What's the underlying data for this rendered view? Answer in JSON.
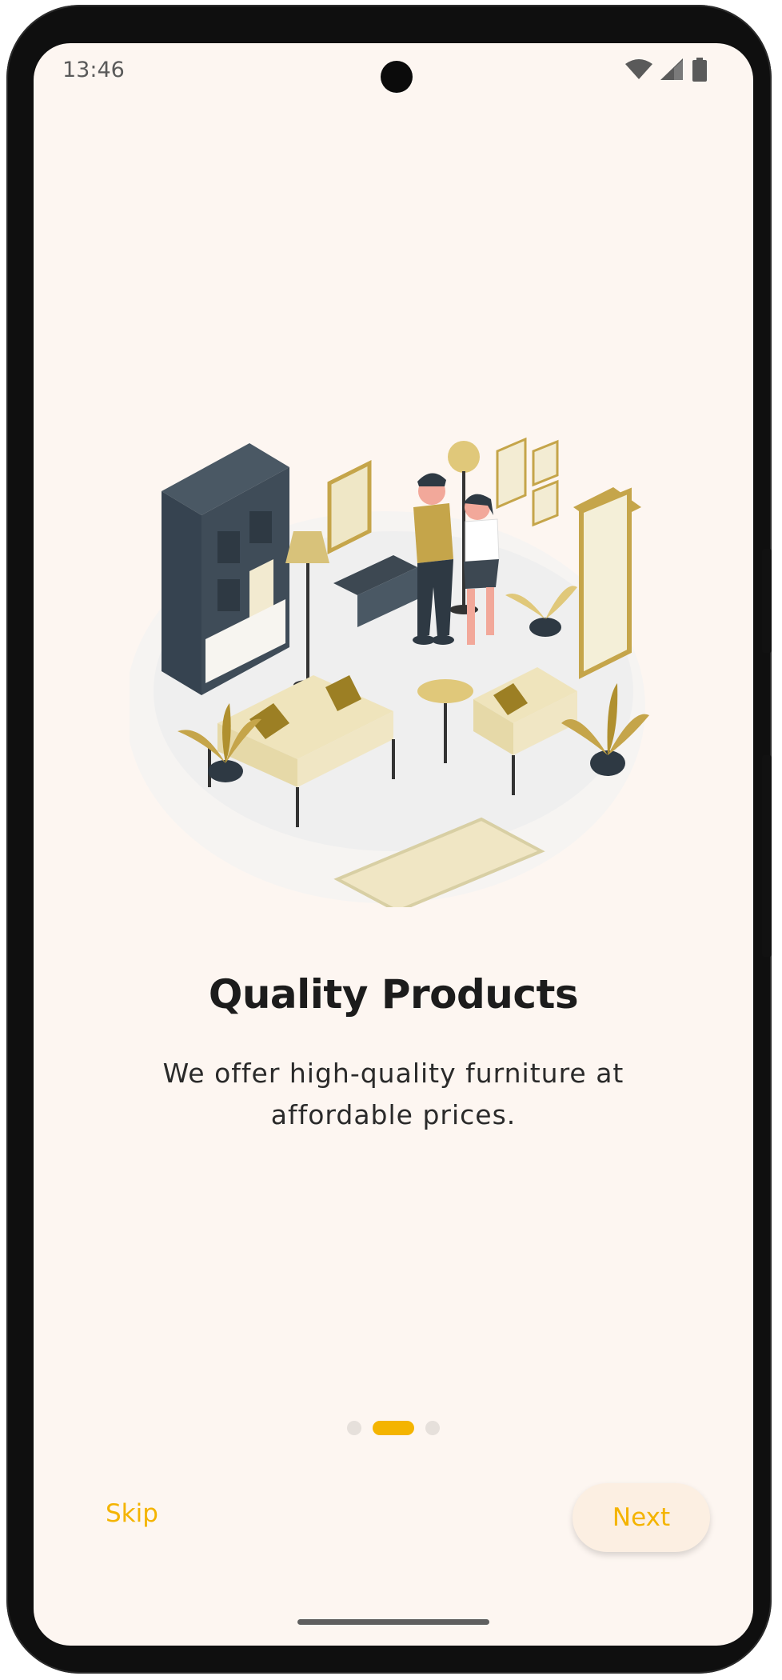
{
  "status_bar": {
    "time": "13:46",
    "icons": [
      "wifi-icon",
      "signal-icon",
      "battery-icon"
    ]
  },
  "onboarding": {
    "title": "Quality Products",
    "description": "We offer high-quality furniture at affordable prices.",
    "page_indicator": {
      "total": 3,
      "active_index": 1
    },
    "skip_label": "Skip",
    "next_label": "Next"
  },
  "colors": {
    "accent": "#f4b400",
    "background": "#fdf6f1",
    "next_button_bg": "#fcefe2",
    "title": "#1c1c1c"
  }
}
